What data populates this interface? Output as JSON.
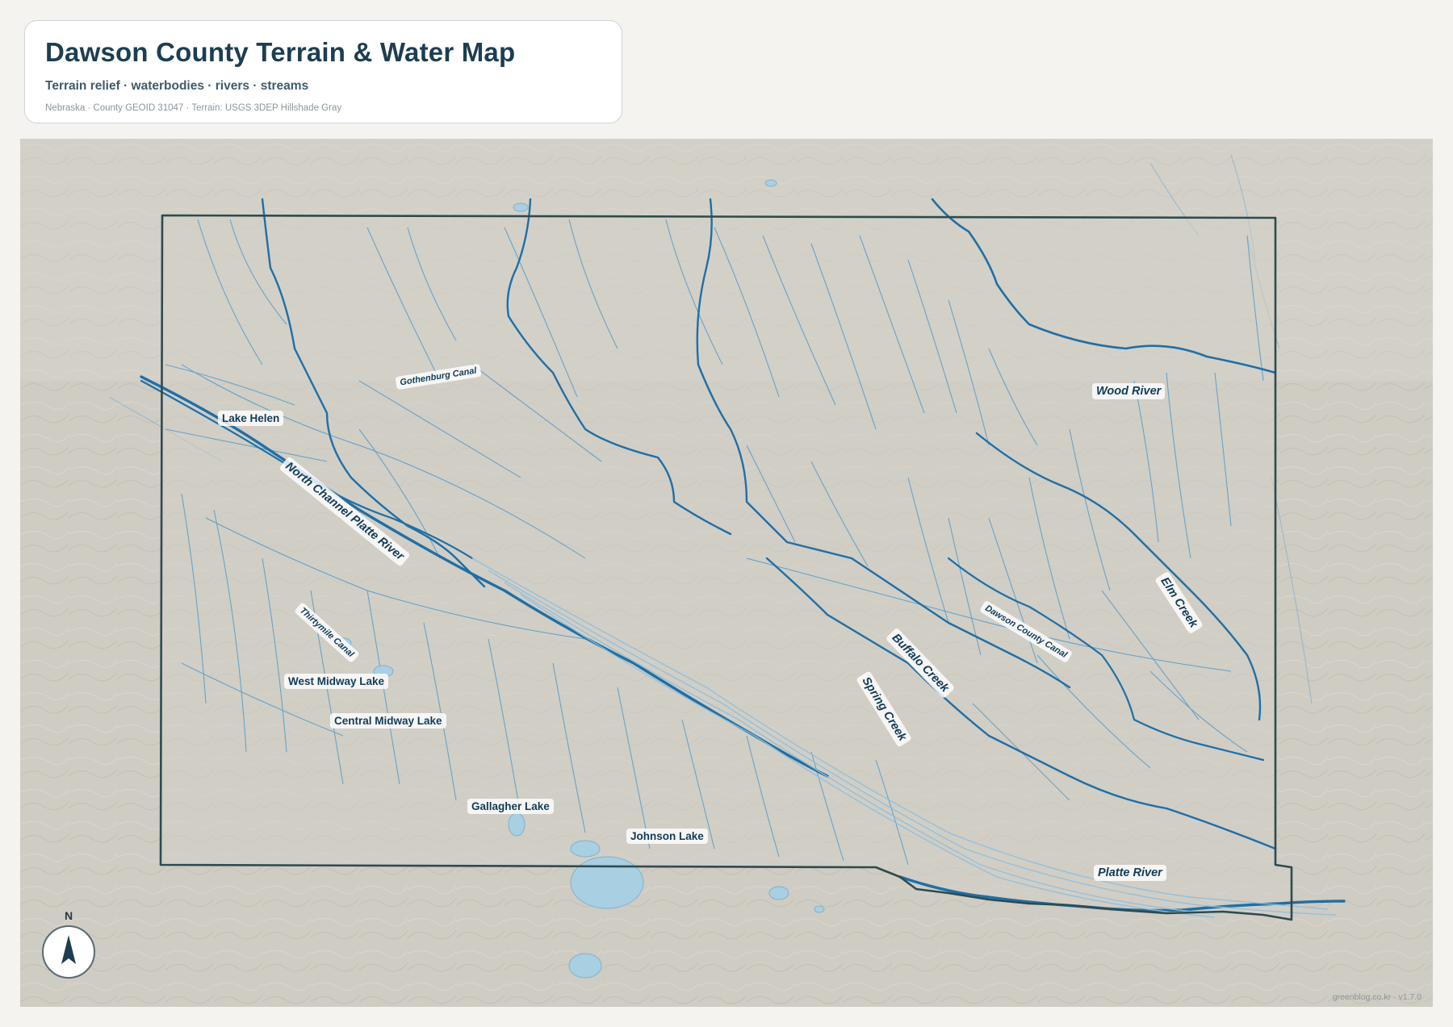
{
  "header": {
    "title": "Dawson County Terrain & Water Map",
    "subtitle": "Terrain relief · waterbodies · rivers · streams",
    "meta": "Nebraska · County GEOID 31047 · Terrain: USGS 3DEP Hillshade Gray"
  },
  "compass": {
    "label": "N",
    "icon": "north-arrow-icon"
  },
  "credit": "greenblog.co.kr · v1.7.0",
  "colors": {
    "land": "#cfccc3",
    "boundary": "#2f4a4f",
    "river": "#1f6fa6",
    "stream": "#4f98c6",
    "lake": "#a9cfe3",
    "label_text": "#123c57"
  },
  "labels": {
    "lakes": [
      "Lake Helen",
      "West Midway Lake",
      "Central Midway Lake",
      "Gallagher Lake",
      "Johnson Lake"
    ],
    "rivers": [
      "North Channel Platte River",
      "Wood River",
      "Buffalo Creek",
      "Spring Creek",
      "Elm Creek",
      "Platte River"
    ],
    "canals": [
      "Gothenburg Canal",
      "Thirtymile Canal",
      "Dawson County Canal"
    ]
  }
}
